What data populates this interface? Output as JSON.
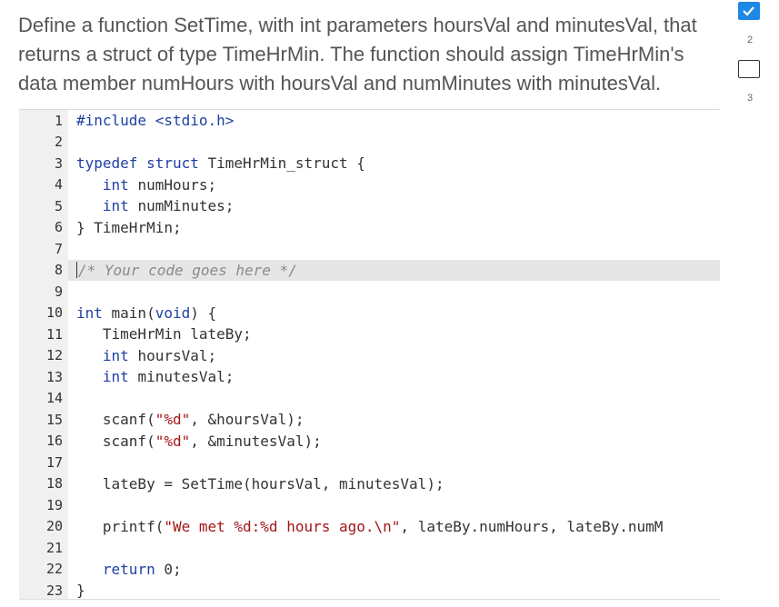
{
  "prompt": {
    "text": "Define a function SetTime, with int parameters hoursVal and minutesVal, that returns a struct of type TimeHrMin. The function should assign TimeHrMin's data member numHours with hoursVal and numMinutes with minutesVal."
  },
  "editor": {
    "active_line": 8,
    "lines": [
      {
        "n": "1",
        "tokens": [
          {
            "t": "#include <stdio.h>",
            "c": "kw"
          }
        ]
      },
      {
        "n": "2",
        "tokens": []
      },
      {
        "n": "3",
        "tokens": [
          {
            "t": "typedef struct ",
            "c": "kw"
          },
          {
            "t": "TimeHrMin_struct {",
            "c": ""
          }
        ]
      },
      {
        "n": "4",
        "tokens": [
          {
            "t": "   ",
            "c": ""
          },
          {
            "t": "int ",
            "c": "kw"
          },
          {
            "t": "numHours;",
            "c": ""
          }
        ]
      },
      {
        "n": "5",
        "tokens": [
          {
            "t": "   ",
            "c": ""
          },
          {
            "t": "int ",
            "c": "kw"
          },
          {
            "t": "numMinutes;",
            "c": ""
          }
        ]
      },
      {
        "n": "6",
        "tokens": [
          {
            "t": "} TimeHrMin;",
            "c": ""
          }
        ]
      },
      {
        "n": "7",
        "tokens": []
      },
      {
        "n": "8",
        "tokens": [
          {
            "t": "/* Your code goes here */",
            "c": "comment"
          }
        ]
      },
      {
        "n": "9",
        "tokens": []
      },
      {
        "n": "10",
        "tokens": [
          {
            "t": "int ",
            "c": "kw"
          },
          {
            "t": "main(",
            "c": ""
          },
          {
            "t": "void",
            "c": "kw"
          },
          {
            "t": ") {",
            "c": ""
          }
        ]
      },
      {
        "n": "11",
        "tokens": [
          {
            "t": "   TimeHrMin lateBy;",
            "c": ""
          }
        ]
      },
      {
        "n": "12",
        "tokens": [
          {
            "t": "   ",
            "c": ""
          },
          {
            "t": "int ",
            "c": "kw"
          },
          {
            "t": "hoursVal;",
            "c": ""
          }
        ]
      },
      {
        "n": "13",
        "tokens": [
          {
            "t": "   ",
            "c": ""
          },
          {
            "t": "int ",
            "c": "kw"
          },
          {
            "t": "minutesVal;",
            "c": ""
          }
        ]
      },
      {
        "n": "14",
        "tokens": []
      },
      {
        "n": "15",
        "tokens": [
          {
            "t": "   scanf(",
            "c": ""
          },
          {
            "t": "\"%d\"",
            "c": "str"
          },
          {
            "t": ", &hoursVal);",
            "c": ""
          }
        ]
      },
      {
        "n": "16",
        "tokens": [
          {
            "t": "   scanf(",
            "c": ""
          },
          {
            "t": "\"%d\"",
            "c": "str"
          },
          {
            "t": ", &minutesVal);",
            "c": ""
          }
        ]
      },
      {
        "n": "17",
        "tokens": []
      },
      {
        "n": "18",
        "tokens": [
          {
            "t": "   lateBy = SetTime(hoursVal, minutesVal);",
            "c": ""
          }
        ]
      },
      {
        "n": "19",
        "tokens": []
      },
      {
        "n": "20",
        "tokens": [
          {
            "t": "   printf(",
            "c": ""
          },
          {
            "t": "\"We met %d:%d hours ago.\\n\"",
            "c": "str"
          },
          {
            "t": ", lateBy.numHours, lateBy.numM",
            "c": ""
          }
        ]
      },
      {
        "n": "21",
        "tokens": []
      },
      {
        "n": "22",
        "tokens": [
          {
            "t": "   ",
            "c": ""
          },
          {
            "t": "return ",
            "c": "kw"
          },
          {
            "t": "0;",
            "c": ""
          }
        ]
      },
      {
        "n": "23",
        "tokens": [
          {
            "t": "}",
            "c": ""
          }
        ]
      }
    ]
  },
  "progress": {
    "steps": [
      {
        "label": "",
        "state": "done"
      },
      {
        "label": "2",
        "state": "number"
      },
      {
        "label": "",
        "state": "pending"
      },
      {
        "label": "3",
        "state": "number"
      }
    ],
    "accent": "#1e88e5"
  }
}
